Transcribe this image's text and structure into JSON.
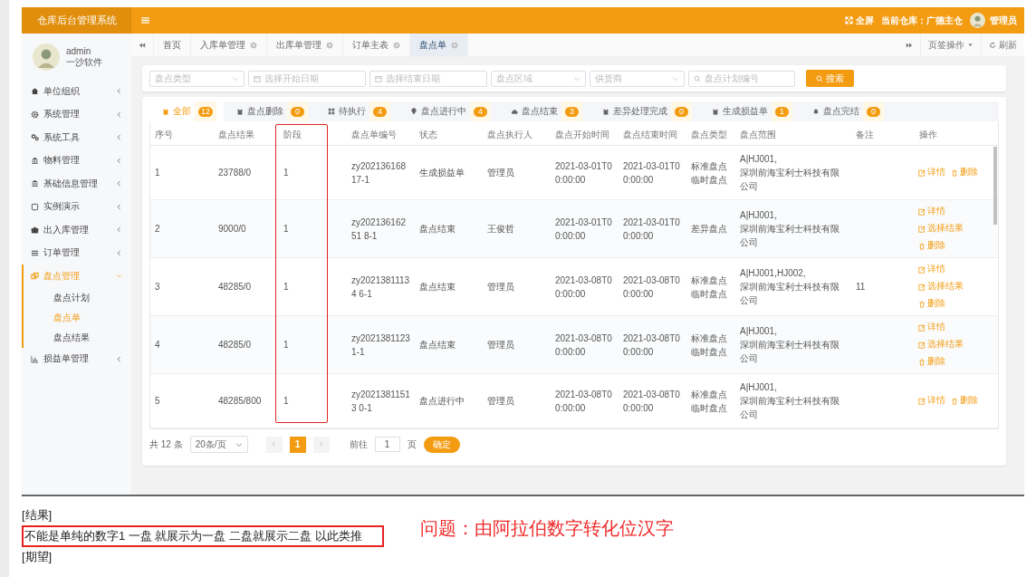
{
  "app": {
    "title": "仓库后台管理系统",
    "header": {
      "fullscreen": "全屏",
      "warehouse": "当前仓库：广德主仓",
      "user": "管理员"
    }
  },
  "sidebar": {
    "user": {
      "name": "admin",
      "org": "一沙软件"
    },
    "items": [
      {
        "label": "单位组织",
        "expanded": false,
        "selected": false
      },
      {
        "label": "系统管理",
        "expanded": false,
        "selected": false
      },
      {
        "label": "系统工具",
        "expanded": false,
        "selected": false
      },
      {
        "label": "物料管理",
        "expanded": false,
        "selected": false
      },
      {
        "label": "基础信息管理",
        "expanded": false,
        "selected": false
      },
      {
        "label": "实例演示",
        "expanded": false,
        "selected": false
      },
      {
        "label": "出入库管理",
        "expanded": false,
        "selected": false
      },
      {
        "label": "订单管理",
        "expanded": false,
        "selected": false
      },
      {
        "label": "盘点管理",
        "expanded": true,
        "selected": true,
        "children": [
          {
            "label": "盘点计划",
            "selected": false
          },
          {
            "label": "盘点单",
            "selected": true
          },
          {
            "label": "盘点结果",
            "selected": false
          }
        ]
      },
      {
        "label": "损益单管理",
        "expanded": false,
        "selected": false
      }
    ]
  },
  "page_tabs": [
    {
      "label": "首页",
      "selected": false,
      "closable": false
    },
    {
      "label": "入库单管理",
      "selected": false,
      "closable": true
    },
    {
      "label": "出库单管理",
      "selected": false,
      "closable": true
    },
    {
      "label": "订单主表",
      "selected": false,
      "closable": true
    },
    {
      "label": "盘点单",
      "selected": true,
      "closable": true
    }
  ],
  "tab_tools": {
    "actions": "页签操作",
    "refresh": "刷新"
  },
  "filters": [
    {
      "kind": "select",
      "placeholder": "盘点类型"
    },
    {
      "kind": "date",
      "placeholder": "选择开始日期"
    },
    {
      "kind": "date",
      "placeholder": "选择结束日期"
    },
    {
      "kind": "select",
      "placeholder": "盘点区域"
    },
    {
      "kind": "select",
      "placeholder": "供货商"
    },
    {
      "kind": "search",
      "placeholder": "盘点计划编号"
    }
  ],
  "search_button": "搜索",
  "status_tabs": [
    {
      "label": "全部",
      "count": "12",
      "selected": true
    },
    {
      "label": "盘点删除",
      "count": "0",
      "selected": false
    },
    {
      "label": "待执行",
      "count": "4",
      "selected": false
    },
    {
      "label": "盘点进行中",
      "count": "4",
      "selected": false
    },
    {
      "label": "盘点结束",
      "count": "3",
      "selected": false
    },
    {
      "label": "差异处理完成",
      "count": "0",
      "selected": false
    },
    {
      "label": "生成损益单",
      "count": "1",
      "selected": false
    },
    {
      "label": "盘点完结",
      "count": "0",
      "selected": false
    }
  ],
  "table": {
    "columns": [
      "序号",
      "盘点结果",
      "阶段",
      "盘点单编号",
      "状态",
      "盘点执行人",
      "盘点开始时间",
      "盘点结束时间",
      "盘点类型",
      "盘点范围",
      "备注",
      "操作"
    ],
    "rows": [
      {
        "cells": [
          "1",
          "23788/0",
          "1",
          "zy20213616817-1",
          "生成损益单",
          "管理员",
          "2021-03-01T00:00:00",
          "2021-03-01T00:00:00",
          "标准盘点临时盘点",
          "A|HJ001,\n深圳前海宝利士科技有限公司",
          ""
        ],
        "actions": [
          {
            "kind": "edit",
            "label": "详情"
          },
          {
            "kind": "delete",
            "label": "删除"
          }
        ]
      },
      {
        "cells": [
          "2",
          "9000/0",
          "1",
          "zy20213616251 8-1",
          "盘点结束",
          "王俊哲",
          "2021-03-01T00:00:00",
          "2021-03-01T00:00:00",
          "差异盘点",
          "A|HJ001,\n深圳前海宝利士科技有限公司",
          ""
        ],
        "actions": [
          {
            "kind": "edit",
            "label": "详情"
          },
          {
            "kind": "edit",
            "label": "选择结果"
          },
          {
            "kind": "delete",
            "label": "删除"
          }
        ]
      },
      {
        "cells": [
          "3",
          "48285/0",
          "1",
          "zy20213811134 6-1",
          "盘点结束",
          "管理员",
          "2021-03-08T00:00:00",
          "2021-03-08T00:00:00",
          "标准盘点临时盘点",
          "A|HJ001,HJ002,\n深圳前海宝利士科技有限公司",
          "11"
        ],
        "actions": [
          {
            "kind": "edit",
            "label": "详情"
          },
          {
            "kind": "edit",
            "label": "选择结果"
          },
          {
            "kind": "delete",
            "label": "删除"
          }
        ]
      },
      {
        "cells": [
          "4",
          "48285/0",
          "1",
          "zy20213811231-1",
          "盘点结束",
          "管理员",
          "2021-03-08T00:00:00",
          "2021-03-08T00:00:00",
          "标准盘点临时盘点",
          "A|HJ001,\n深圳前海宝利士科技有限公司",
          ""
        ],
        "actions": [
          {
            "kind": "edit",
            "label": "详情"
          },
          {
            "kind": "edit",
            "label": "选择结果"
          },
          {
            "kind": "delete",
            "label": "删除"
          }
        ]
      },
      {
        "cells": [
          "5",
          "48285/800",
          "1",
          "zy20213811513 0-1",
          "盘点进行中",
          "管理员",
          "2021-03-08T00:00:00",
          "2021-03-08T00:00:00",
          "标准盘点临时盘点",
          "A|HJ001,\n深圳前海宝利士科技有限公司",
          ""
        ],
        "actions": [
          {
            "kind": "edit",
            "label": "详情"
          },
          {
            "kind": "delete",
            "label": "删除"
          }
        ]
      }
    ]
  },
  "pagination": {
    "total": "共 12 条",
    "page_size": "20条/页",
    "pages": [
      {
        "label": "1",
        "selected": true
      }
    ],
    "goto_label": "前往",
    "goto_value": "1",
    "goto_unit": "页",
    "confirm": "确定"
  },
  "document": {
    "result_heading": "[结果]",
    "result_text": "不能是单纯的数字1  一盘 就展示为一盘  二盘就展示二盘 以此类推",
    "expect_heading": "[期望]",
    "annotation": "问题：由阿拉伯数字转化位汉字"
  }
}
